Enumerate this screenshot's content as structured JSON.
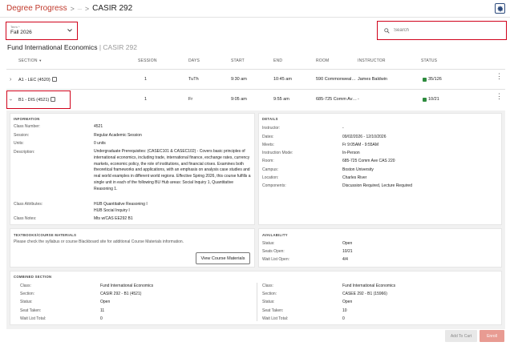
{
  "breadcrumb": {
    "root": "Degree Progress",
    "sep": ">",
    "ellipsis": "...",
    "current": "CASIR 292"
  },
  "term": {
    "label": "Term *",
    "value": "Fall 2026"
  },
  "search": {
    "placeholder": "Search"
  },
  "course": {
    "name": "Fund International Economics",
    "separator": "|",
    "code": "CASIR 292"
  },
  "columns": {
    "section": "SECTION",
    "session": "SESSION",
    "days": "DAYS",
    "start": "START",
    "end": "END",
    "room": "ROOM",
    "instructor": "INSTRUCTOR",
    "status": "STATUS"
  },
  "sections": [
    {
      "name": "A1 - LEC (4520)",
      "session": "1",
      "days": "TuTh",
      "start": "9:30 am",
      "end": "10:45 am",
      "room": "590 Commonweal…",
      "instructor": "James Baldwin",
      "status": "35/126",
      "expanded": false
    },
    {
      "name": "B1 - DIS (4521)",
      "session": "1",
      "days": "Fr",
      "start": "9:05 am",
      "end": "9:55 am",
      "room": "685-725 Comm Av…",
      "instructor": "-",
      "status": "10/21",
      "expanded": true
    }
  ],
  "information": {
    "title": "INFORMATION",
    "class_number_label": "Class Number:",
    "class_number": "4521",
    "session_label": "Session:",
    "session": "Regular Academic Session",
    "units_label": "Units:",
    "units": "0 units",
    "description_label": "Description:",
    "description": "Undergraduate Prerequisites: (CASEC101 & CASEC102) - Covers basic principles of international economics, including trade, international finance, exchange rates, currency markets, economic policy, the role of institutions, and financial crises. Examines both theoretical frameworks and applications, with an emphasis on analysis case studies and real world examples in different world regions. Effective Spring 2026, this course fulfills a single unit in each of the following BU Hub areas: Social Inquiry 1, Quantitative Reasoning 1.",
    "attributes_label": "Class Attributes:",
    "attribute_1": "HUB Quantitative Reasoning I",
    "attribute_2": "HUB Social Inquiry I",
    "notes_label": "Class Notes:",
    "notes": "Mts w/CAS EE292 B1"
  },
  "details": {
    "title": "DETAILS",
    "instructor_label": "Instructor:",
    "instructor": "-",
    "dates_label": "Dates:",
    "dates": "09/02/2026 - 12/10/2026",
    "meets_label": "Meets:",
    "meets": "Fr 9:05AM - 9:55AM",
    "mode_label": "Instruction Mode:",
    "mode": "In-Person",
    "room_label": "Room:",
    "room": "685-725 Comm Ave CAS 220",
    "campus_label": "Campus:",
    "campus": "Boston University",
    "location_label": "Location:",
    "location": "Charles River",
    "components_label": "Components:",
    "components": "Discussion Required, Lecture Required"
  },
  "textbooks": {
    "title": "TEXTBOOKS/COURSE MATERIALS",
    "text": "Please check the syllabus or course Blackboard site for additional Course Materials information.",
    "button": "View Course Materials"
  },
  "availability": {
    "title": "AVAILABILITY",
    "status_label": "Status:",
    "status": "Open",
    "seats_label": "Seats Open:",
    "seats": "10/21",
    "waitlist_label": "Wait List Open:",
    "waitlist": "4/4"
  },
  "combined": {
    "title": "COMBINED SECTION",
    "left": {
      "class_label": "Class:",
      "class": "Fund International Economics",
      "section_label": "Section:",
      "section": "CASIR 292 - B1 (4521)",
      "status_label": "Status:",
      "status": "Open",
      "seat_label": "Seat Taken:",
      "seat": "11",
      "wait_label": "Wait List Total:",
      "wait": "0"
    },
    "right": {
      "class_label": "Class:",
      "class": "Fund International Economics",
      "section_label": "Section:",
      "section": "CASEE 292 - B1 (15966)",
      "status_label": "Status:",
      "status": "Open",
      "seat_label": "Seat Taken:",
      "seat": "10",
      "wait_label": "Wait List Total:",
      "wait": "0"
    }
  },
  "actions": {
    "add_to_cart": "Add To Cart",
    "enroll": "Enroll"
  },
  "icons": {
    "gear": "gear-icon",
    "search": "search-icon",
    "chevron": "chevron-down-icon",
    "note": "note-icon",
    "kebab": "kebab-icon"
  },
  "colors": {
    "accent": "#c0392b",
    "highlight_box": "#d0021b",
    "open_status": "#2e8b3e",
    "enroll_button": "#e89b92"
  }
}
